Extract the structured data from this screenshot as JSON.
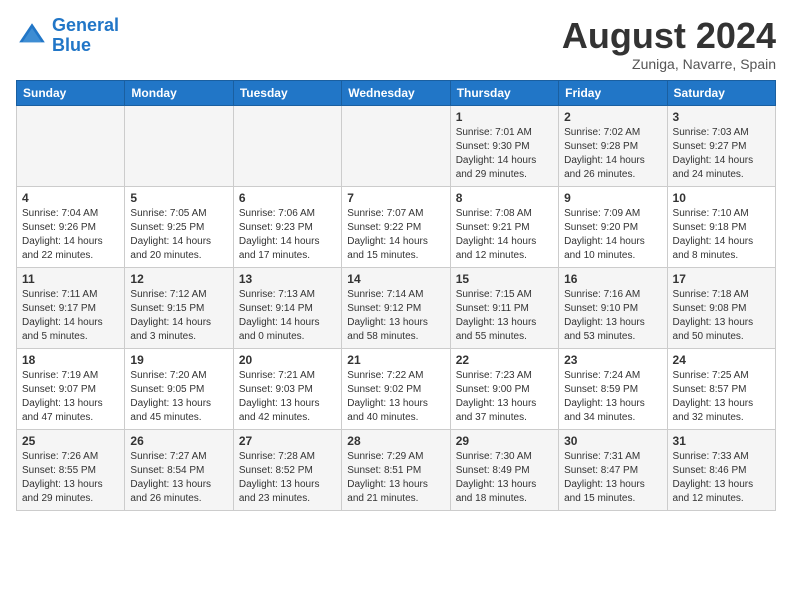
{
  "header": {
    "logo_line1": "General",
    "logo_line2": "Blue",
    "month_title": "August 2024",
    "location": "Zuniga, Navarre, Spain"
  },
  "days_of_week": [
    "Sunday",
    "Monday",
    "Tuesday",
    "Wednesday",
    "Thursday",
    "Friday",
    "Saturday"
  ],
  "weeks": [
    [
      {
        "day": "",
        "info": ""
      },
      {
        "day": "",
        "info": ""
      },
      {
        "day": "",
        "info": ""
      },
      {
        "day": "",
        "info": ""
      },
      {
        "day": "1",
        "info": "Sunrise: 7:01 AM\nSunset: 9:30 PM\nDaylight: 14 hours\nand 29 minutes."
      },
      {
        "day": "2",
        "info": "Sunrise: 7:02 AM\nSunset: 9:28 PM\nDaylight: 14 hours\nand 26 minutes."
      },
      {
        "day": "3",
        "info": "Sunrise: 7:03 AM\nSunset: 9:27 PM\nDaylight: 14 hours\nand 24 minutes."
      }
    ],
    [
      {
        "day": "4",
        "info": "Sunrise: 7:04 AM\nSunset: 9:26 PM\nDaylight: 14 hours\nand 22 minutes."
      },
      {
        "day": "5",
        "info": "Sunrise: 7:05 AM\nSunset: 9:25 PM\nDaylight: 14 hours\nand 20 minutes."
      },
      {
        "day": "6",
        "info": "Sunrise: 7:06 AM\nSunset: 9:23 PM\nDaylight: 14 hours\nand 17 minutes."
      },
      {
        "day": "7",
        "info": "Sunrise: 7:07 AM\nSunset: 9:22 PM\nDaylight: 14 hours\nand 15 minutes."
      },
      {
        "day": "8",
        "info": "Sunrise: 7:08 AM\nSunset: 9:21 PM\nDaylight: 14 hours\nand 12 minutes."
      },
      {
        "day": "9",
        "info": "Sunrise: 7:09 AM\nSunset: 9:20 PM\nDaylight: 14 hours\nand 10 minutes."
      },
      {
        "day": "10",
        "info": "Sunrise: 7:10 AM\nSunset: 9:18 PM\nDaylight: 14 hours\nand 8 minutes."
      }
    ],
    [
      {
        "day": "11",
        "info": "Sunrise: 7:11 AM\nSunset: 9:17 PM\nDaylight: 14 hours\nand 5 minutes."
      },
      {
        "day": "12",
        "info": "Sunrise: 7:12 AM\nSunset: 9:15 PM\nDaylight: 14 hours\nand 3 minutes."
      },
      {
        "day": "13",
        "info": "Sunrise: 7:13 AM\nSunset: 9:14 PM\nDaylight: 14 hours\nand 0 minutes."
      },
      {
        "day": "14",
        "info": "Sunrise: 7:14 AM\nSunset: 9:12 PM\nDaylight: 13 hours\nand 58 minutes."
      },
      {
        "day": "15",
        "info": "Sunrise: 7:15 AM\nSunset: 9:11 PM\nDaylight: 13 hours\nand 55 minutes."
      },
      {
        "day": "16",
        "info": "Sunrise: 7:16 AM\nSunset: 9:10 PM\nDaylight: 13 hours\nand 53 minutes."
      },
      {
        "day": "17",
        "info": "Sunrise: 7:18 AM\nSunset: 9:08 PM\nDaylight: 13 hours\nand 50 minutes."
      }
    ],
    [
      {
        "day": "18",
        "info": "Sunrise: 7:19 AM\nSunset: 9:07 PM\nDaylight: 13 hours\nand 47 minutes."
      },
      {
        "day": "19",
        "info": "Sunrise: 7:20 AM\nSunset: 9:05 PM\nDaylight: 13 hours\nand 45 minutes."
      },
      {
        "day": "20",
        "info": "Sunrise: 7:21 AM\nSunset: 9:03 PM\nDaylight: 13 hours\nand 42 minutes."
      },
      {
        "day": "21",
        "info": "Sunrise: 7:22 AM\nSunset: 9:02 PM\nDaylight: 13 hours\nand 40 minutes."
      },
      {
        "day": "22",
        "info": "Sunrise: 7:23 AM\nSunset: 9:00 PM\nDaylight: 13 hours\nand 37 minutes."
      },
      {
        "day": "23",
        "info": "Sunrise: 7:24 AM\nSunset: 8:59 PM\nDaylight: 13 hours\nand 34 minutes."
      },
      {
        "day": "24",
        "info": "Sunrise: 7:25 AM\nSunset: 8:57 PM\nDaylight: 13 hours\nand 32 minutes."
      }
    ],
    [
      {
        "day": "25",
        "info": "Sunrise: 7:26 AM\nSunset: 8:55 PM\nDaylight: 13 hours\nand 29 minutes."
      },
      {
        "day": "26",
        "info": "Sunrise: 7:27 AM\nSunset: 8:54 PM\nDaylight: 13 hours\nand 26 minutes."
      },
      {
        "day": "27",
        "info": "Sunrise: 7:28 AM\nSunset: 8:52 PM\nDaylight: 13 hours\nand 23 minutes."
      },
      {
        "day": "28",
        "info": "Sunrise: 7:29 AM\nSunset: 8:51 PM\nDaylight: 13 hours\nand 21 minutes."
      },
      {
        "day": "29",
        "info": "Sunrise: 7:30 AM\nSunset: 8:49 PM\nDaylight: 13 hours\nand 18 minutes."
      },
      {
        "day": "30",
        "info": "Sunrise: 7:31 AM\nSunset: 8:47 PM\nDaylight: 13 hours\nand 15 minutes."
      },
      {
        "day": "31",
        "info": "Sunrise: 7:33 AM\nSunset: 8:46 PM\nDaylight: 13 hours\nand 12 minutes."
      }
    ]
  ]
}
